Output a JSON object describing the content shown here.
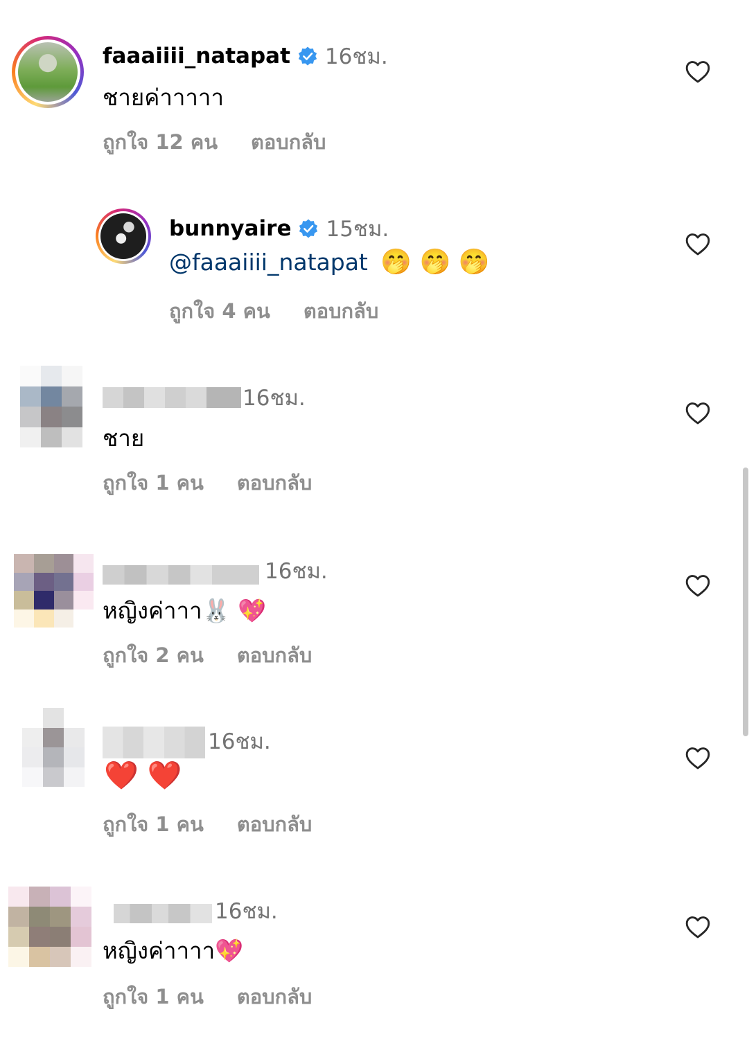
{
  "comments": [
    {
      "username": "faaaiiii_natapat",
      "time": "16ชม.",
      "text": "ชายค่าาาาา",
      "likes": "ถูกใจ 12 คน",
      "reply": "ตอบกลับ",
      "verified": true
    },
    {
      "username": "bunnyaire",
      "time": "15ชม.",
      "mention": "@faaaiiii_natapat",
      "emojis": "🤭 🤭 🤭",
      "likes": "ถูกใจ 4 คน",
      "reply": "ตอบกลับ",
      "verified": true
    },
    {
      "time": "16ชม.",
      "text": "ชาย",
      "likes": "ถูกใจ 1 คน",
      "reply": "ตอบกลับ"
    },
    {
      "time": "16ชม.",
      "text": "หญิงค่าาา🐰 💖",
      "likes": "ถูกใจ 2 คน",
      "reply": "ตอบกลับ"
    },
    {
      "time": "16ชม.",
      "text": "❤️ ❤️",
      "likes": "ถูกใจ 1 คน",
      "reply": "ตอบกลับ"
    },
    {
      "time": "16ชม.",
      "text": "หญิงค่าาาา💖",
      "likes": "ถูกใจ 1 คน",
      "reply": "ตอบกลับ"
    }
  ],
  "icons": {
    "like": "heart-outline-icon",
    "verified": "verified-badge-icon"
  },
  "colors": {
    "verified": "#3897f0",
    "mention": "#00376b",
    "meta": "#8e8e8e",
    "time": "#737373"
  }
}
